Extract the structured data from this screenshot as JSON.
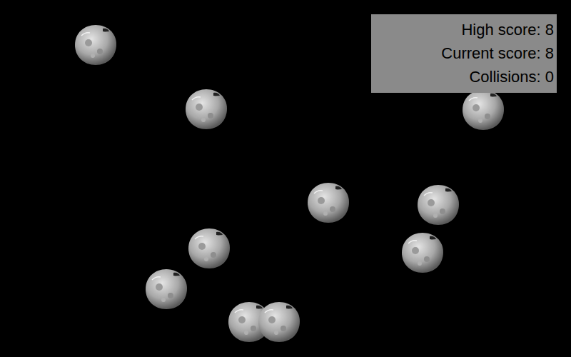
{
  "scoreboard": [
    {
      "text": "High score: 8"
    },
    {
      "text": "Current score: 8"
    },
    {
      "text": "Collisions: 0"
    }
  ]
}
